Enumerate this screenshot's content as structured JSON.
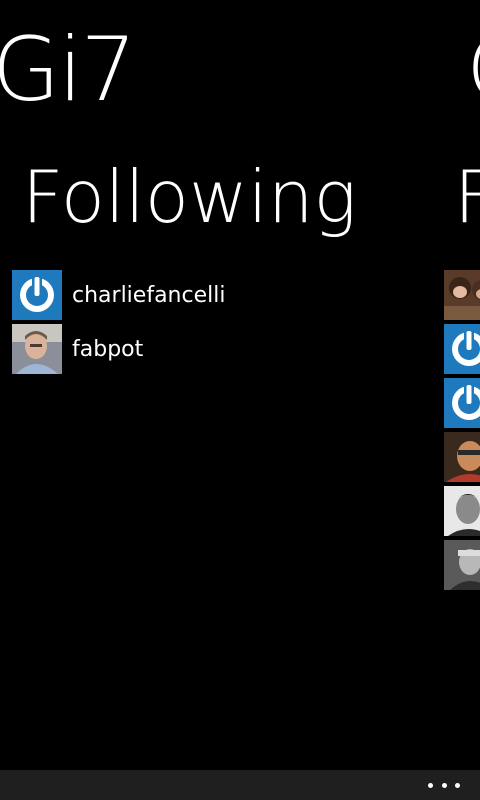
{
  "app": {
    "title": "Gi7",
    "next_title_peek": "G"
  },
  "pivot": {
    "current_header": "Following",
    "next_header_peek": "F"
  },
  "following": [
    {
      "username": "charliefancelli",
      "avatar_icon": "power-logo-icon"
    },
    {
      "username": "fabpot",
      "avatar_icon": "user-photo"
    }
  ],
  "followers_peek": [
    {
      "avatar_icon": "monkey-photo"
    },
    {
      "avatar_icon": "power-logo-icon"
    },
    {
      "avatar_icon": "power-logo-icon"
    },
    {
      "avatar_icon": "user-photo"
    },
    {
      "avatar_icon": "user-photo"
    },
    {
      "avatar_icon": "user-photo"
    }
  ],
  "colors": {
    "accent": "#1f79bd",
    "background": "#000000",
    "app_bar": "#1f1f1f"
  },
  "app_bar": {
    "more_icon": "ellipsis-icon"
  }
}
